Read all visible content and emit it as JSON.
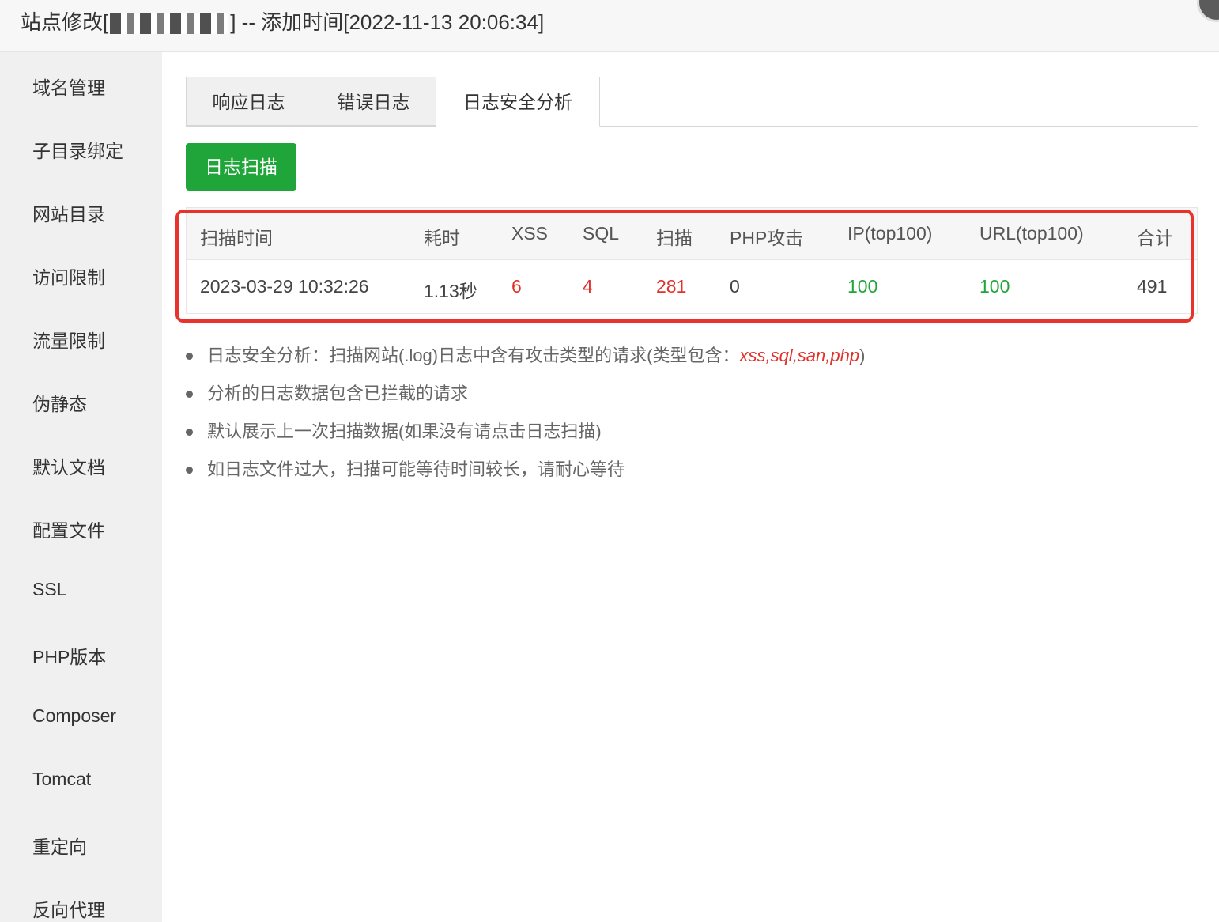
{
  "window": {
    "title_prefix": "站点修改[",
    "title_suffix": "] -- 添加时间[2022-11-13 20:06:34]"
  },
  "sidebar": {
    "items": [
      {
        "label": "域名管理"
      },
      {
        "label": "子目录绑定"
      },
      {
        "label": "网站目录"
      },
      {
        "label": "访问限制"
      },
      {
        "label": "流量限制"
      },
      {
        "label": "伪静态"
      },
      {
        "label": "默认文档"
      },
      {
        "label": "配置文件"
      },
      {
        "label": "SSL"
      },
      {
        "label": "PHP版本"
      },
      {
        "label": "Composer"
      },
      {
        "label": "Tomcat"
      },
      {
        "label": "重定向"
      },
      {
        "label": "反向代理"
      }
    ]
  },
  "tabs": [
    {
      "label": "响应日志",
      "active": false
    },
    {
      "label": "错误日志",
      "active": false
    },
    {
      "label": "日志安全分析",
      "active": true
    }
  ],
  "scan_button": {
    "label": "日志扫描"
  },
  "table": {
    "headers": [
      "扫描时间",
      "耗时",
      "XSS",
      "SQL",
      "扫描",
      "PHP攻击",
      "IP(top100)",
      "URL(top100)",
      "合计"
    ],
    "rows": [
      [
        "2023-03-29 10:32:26",
        "1.13秒",
        "6",
        "4",
        "281",
        "0",
        "100",
        "100",
        "491"
      ]
    ]
  },
  "colors": {
    "accent_green": "#20a53a",
    "alert_red": "#e0312a",
    "highlight_red": "#e8322b"
  },
  "tips": [
    {
      "text": "日志安全分析：扫描网站(.log)日志中含有攻击类型的请求(类型包含：",
      "emph": "xss,sql,san,php",
      "tail": ")"
    },
    {
      "text": "分析的日志数据包含已拦截的请求",
      "emph": "",
      "tail": ""
    },
    {
      "text": "默认展示上一次扫描数据(如果没有请点击日志扫描)",
      "emph": "",
      "tail": ""
    },
    {
      "text": "如日志文件过大，扫描可能等待时间较长，请耐心等待",
      "emph": "",
      "tail": ""
    }
  ]
}
